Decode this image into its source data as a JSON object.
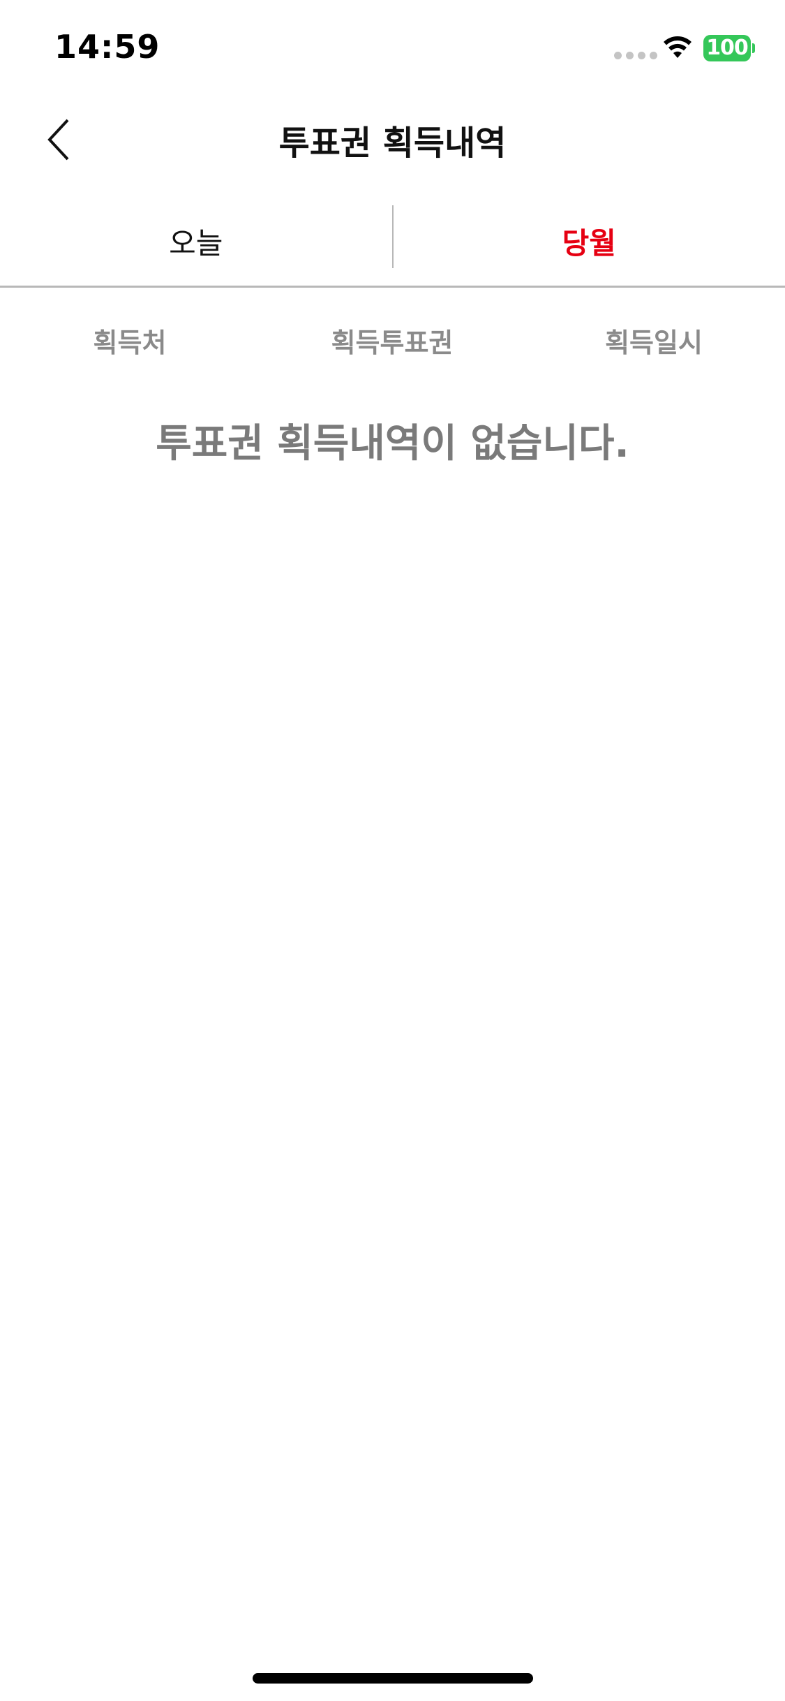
{
  "status_bar": {
    "time": "14:59",
    "battery_level": "100",
    "battery_color": "#34c759",
    "icons": [
      "cellular-signal-icon",
      "wifi-icon",
      "battery-icon"
    ]
  },
  "header": {
    "title": "투표권 획득내역",
    "back_icon": "chevron-left-icon"
  },
  "tabs": [
    {
      "label": "오늘",
      "active": false
    },
    {
      "label": "당월",
      "active": true
    }
  ],
  "columns": [
    "획득처",
    "획득투표권",
    "획득일시"
  ],
  "empty_message": "투표권 획득내역이 없습니다.",
  "colors": {
    "accent": "#e60012",
    "muted_text": "#8a8a8a",
    "divider": "#b8b8b8"
  }
}
